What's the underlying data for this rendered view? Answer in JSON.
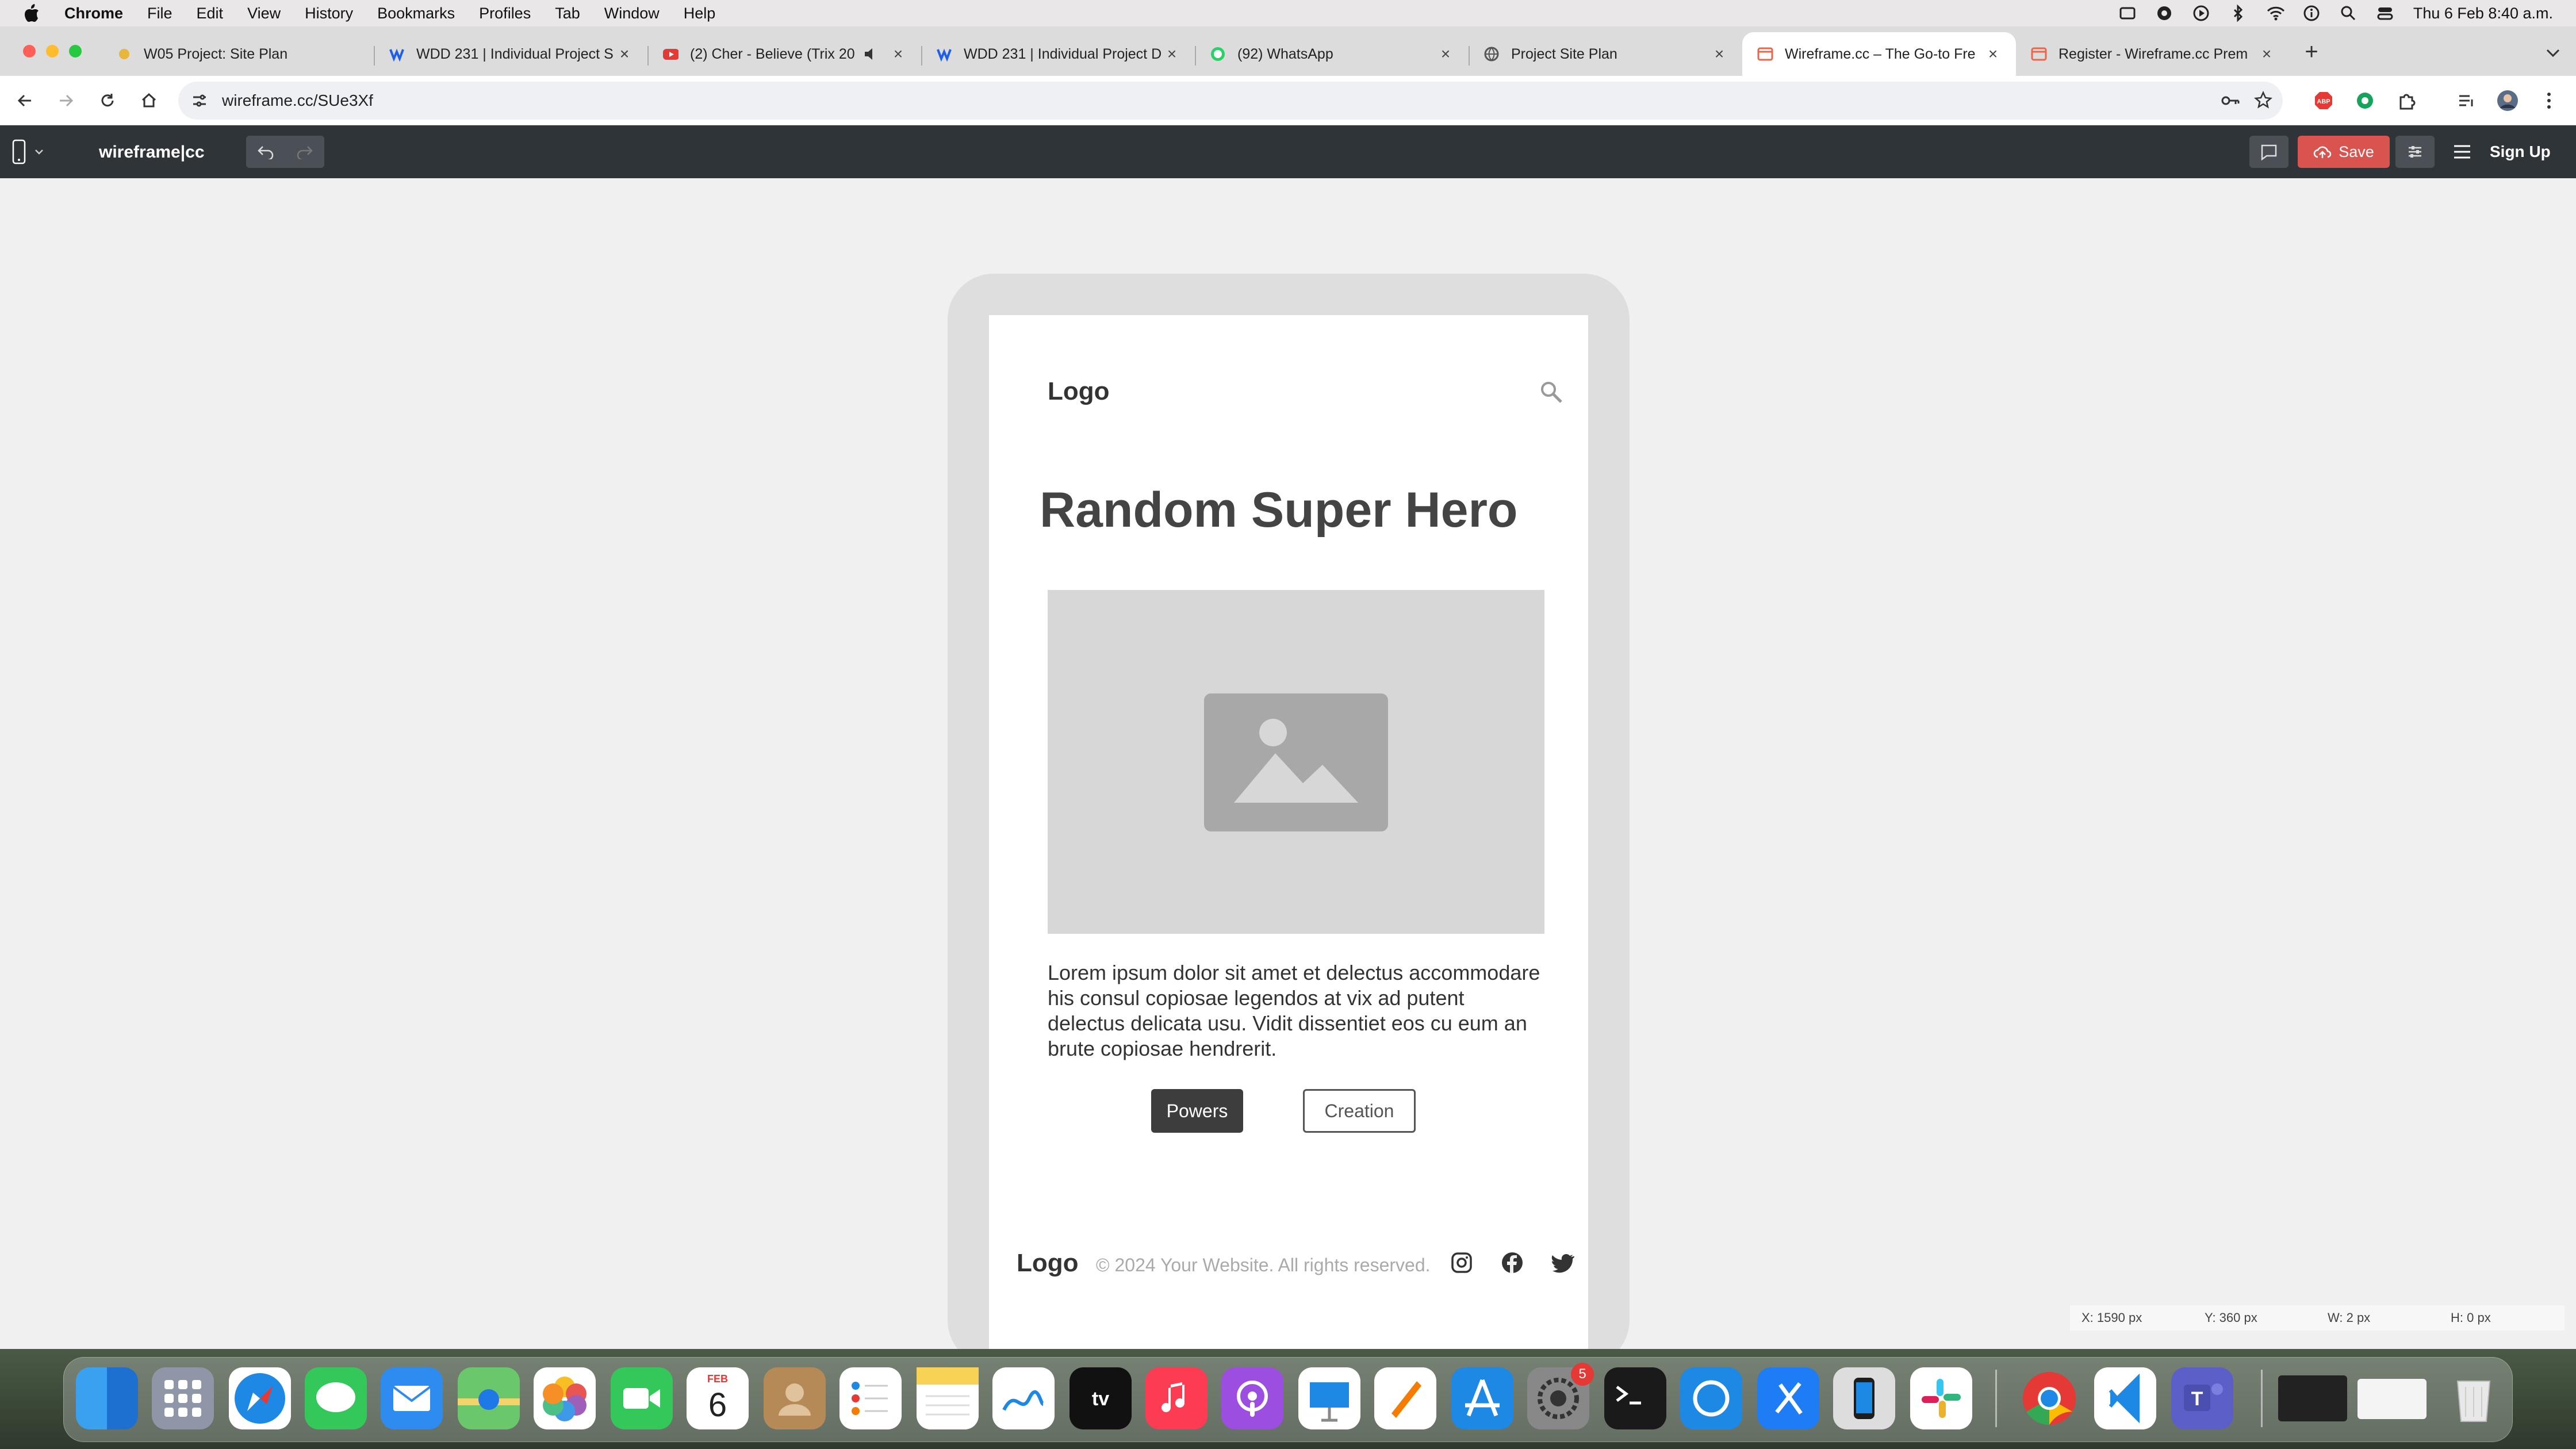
{
  "menubar": {
    "app_name": "Chrome",
    "menus": [
      "File",
      "Edit",
      "View",
      "History",
      "Bookmarks",
      "Profiles",
      "Tab",
      "Window",
      "Help"
    ],
    "clock": "Thu 6 Feb  8:40 a.m."
  },
  "tabs": [
    {
      "title": "W05 Project: Site Plan",
      "icon": "sun-icon",
      "color": "#e7b63b"
    },
    {
      "title": "WDD 231 | Individual Project S",
      "icon": "canvas-w-icon",
      "color": "#1f5fe8"
    },
    {
      "title": "(2) Cher - Believe (Trix 20",
      "icon": "youtube-icon",
      "color": "#e53935"
    },
    {
      "title": "WDD 231 | Individual Project D",
      "icon": "canvas-w-icon",
      "color": "#1f5fe8"
    },
    {
      "title": "(92) WhatsApp",
      "icon": "whatsapp-icon",
      "color": "#25d366"
    },
    {
      "title": "Project Site Plan",
      "icon": "globe-icon",
      "color": "#555555"
    },
    {
      "title": "Wireframe.cc – The Go-to Fre",
      "icon": "wireframe-icon",
      "color": "#e8674a"
    },
    {
      "title": "Register - Wireframe.cc Prem",
      "icon": "wireframe-icon",
      "color": "#e8674a"
    }
  ],
  "active_tab_index": 6,
  "address_bar": {
    "url": "wireframe.cc/SUe3Xf"
  },
  "app": {
    "brand": "wireframe|cc",
    "save_label": "Save",
    "signup_label": "Sign Up",
    "accent_color": "#d9534f"
  },
  "wireframe": {
    "logo": "Logo",
    "hero_title": "Random Super Hero",
    "body_text": "Lorem ipsum dolor sit amet et delectus accommodare his consul copiosae legendos at vix ad putent delectus delicata usu. Vidit dissentiet eos cu eum an brute copiosae hendrerit.",
    "button_primary": "Powers",
    "button_secondary": "Creation",
    "footer_logo": "Logo",
    "footer_copyright": "© 2024 Your Website. All rights reserved."
  },
  "status_bar": {
    "x": "X: 1590 px",
    "y": "Y: 360 px",
    "w": "W: 2 px",
    "h": "H: 0 px"
  },
  "dock": {
    "items": [
      "finder",
      "launchpad",
      "safari",
      "messages",
      "mail",
      "maps",
      "photos",
      "facetime",
      "calendar",
      "contacts",
      "reminders",
      "notes",
      "freeform",
      "tv",
      "music",
      "podcasts",
      "keynote",
      "pages",
      "app-store",
      "system-settings",
      "terminal",
      "sync",
      "xcode",
      "simulator",
      "slack",
      "chrome",
      "vscode",
      "teams"
    ],
    "calendar_month": "FEB",
    "calendar_day": "6",
    "settings_badge": "5"
  }
}
